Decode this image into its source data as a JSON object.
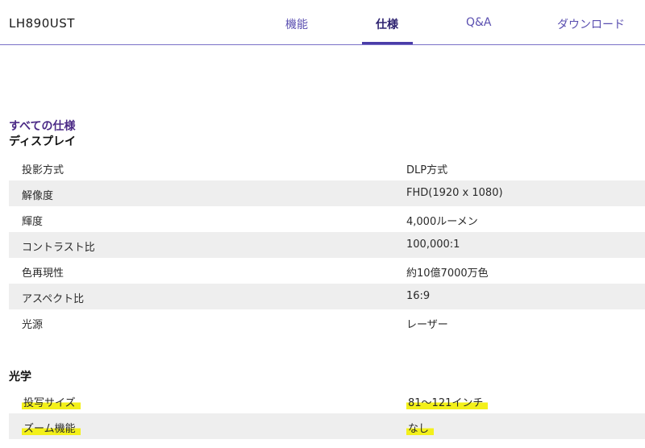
{
  "header": {
    "product_name": "LH890UST",
    "tabs": [
      {
        "label": "機能",
        "active": false
      },
      {
        "label": "仕様",
        "active": true
      },
      {
        "label": "Q&A",
        "active": false
      },
      {
        "label": "ダウンロード",
        "active": false
      }
    ]
  },
  "specs": {
    "kicker": "すべての仕様",
    "display": {
      "heading": "ディスプレイ",
      "rows": [
        {
          "label": "投影方式",
          "value": "DLP方式"
        },
        {
          "label": "解像度",
          "value": "FHD(1920 x 1080)"
        },
        {
          "label": "輝度",
          "value": "4,000ルーメン"
        },
        {
          "label": "コントラスト比",
          "value": "100,000:1"
        },
        {
          "label": "色再現性",
          "value": "約10億7000万色"
        },
        {
          "label": "アスペクト比",
          "value": "16:9"
        },
        {
          "label": "光源",
          "value": "レーザー"
        }
      ]
    },
    "optics": {
      "heading": "光学",
      "rows": [
        {
          "label": "投写サイズ",
          "value": "81～121インチ"
        },
        {
          "label": "ズーム機能",
          "value": "なし"
        }
      ]
    }
  },
  "colors": {
    "accent": "#4a3da8",
    "highlight": "#f3f01a",
    "row_shade": "#eeeeee"
  }
}
